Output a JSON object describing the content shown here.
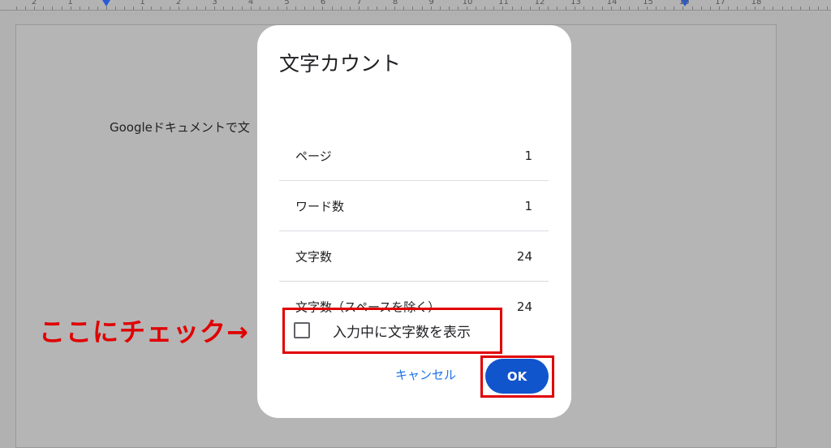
{
  "ruler": {
    "numbers": [
      "2",
      "1",
      "",
      "1",
      "2",
      "3",
      "4",
      "5",
      "6",
      "7",
      "8",
      "9",
      "10",
      "11",
      "12",
      "13",
      "14",
      "15",
      "16",
      "17",
      "18"
    ]
  },
  "document": {
    "text": "Googleドキュメントで文"
  },
  "dialog": {
    "title": "文字カウント",
    "rows": [
      {
        "label": "ページ",
        "value": "1"
      },
      {
        "label": "ワード数",
        "value": "1"
      },
      {
        "label": "文字数",
        "value": "24"
      },
      {
        "label": "文字数（スペースを除く）",
        "value": "24"
      }
    ],
    "checkbox_label": "入力中に文字数を表示",
    "checkbox_checked": false,
    "cancel_label": "キャンセル",
    "ok_label": "OK"
  },
  "annotation": {
    "text": "ここにチェック→",
    "color": "#e00000"
  },
  "colors": {
    "accent": "#1155cc",
    "link": "#1a73e8"
  }
}
